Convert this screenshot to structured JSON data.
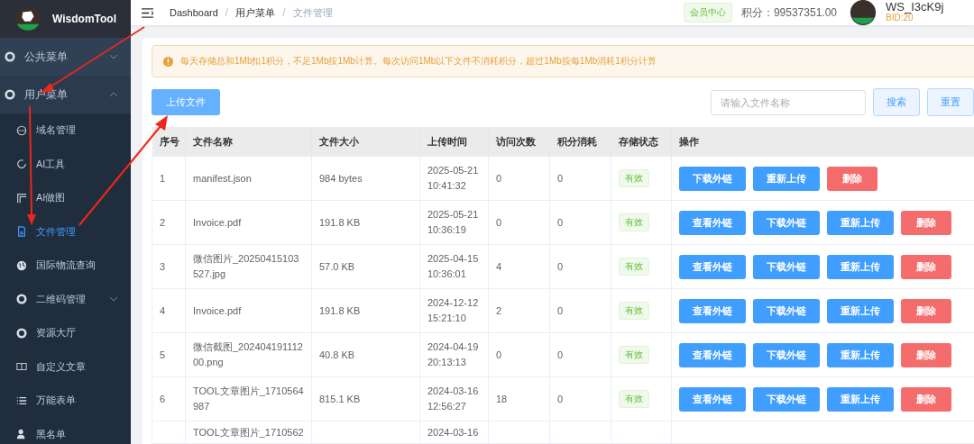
{
  "sidebar": {
    "logo_text": "WisdomTool",
    "items": [
      {
        "label": "公共菜单",
        "expanded": false
      },
      {
        "label": "用户菜单",
        "expanded": true,
        "children": [
          {
            "label": "域名管理",
            "selected": false
          },
          {
            "label": "AI工具",
            "selected": false
          },
          {
            "label": "AI做图",
            "selected": false
          },
          {
            "label": "文件管理",
            "selected": true
          },
          {
            "label": "国际物流查询",
            "selected": false
          },
          {
            "label": "二维码管理",
            "selected": false,
            "expanded": false
          },
          {
            "label": "资源大厅",
            "selected": false
          },
          {
            "label": "自定义文章",
            "selected": false
          },
          {
            "label": "万能表单",
            "selected": false
          },
          {
            "label": "黑名单",
            "selected": false
          }
        ]
      }
    ]
  },
  "header": {
    "breadcrumb": [
      "Dashboard",
      "用户菜单",
      "文件管理"
    ],
    "breadcrumb_separator": "/",
    "member_tag": "会员中心",
    "points": "积分：99537351.00",
    "username": "WS_I3cK9j",
    "bid": "BID:20"
  },
  "notice": "每天存储总和1Mb扣1积分，不足1Mb按1Mb计算。每次访问1Mb以下文件不消耗积分，超过1Mb按每1Mb消耗1积分计算",
  "toolbar": {
    "upload": "上传文件",
    "search_placeholder": "请输入文件名称",
    "search": "搜索",
    "reset": "重置"
  },
  "table": {
    "columns": [
      "序号",
      "文件名称",
      "文件大小",
      "上传时间",
      "访问次数",
      "积分消耗",
      "存储状态",
      "操作"
    ],
    "rows": [
      {
        "index": "1",
        "name": "manifest.json",
        "size": "984 bytes",
        "time": "2025-05-21 10:41:32",
        "visits": "0",
        "cost": "0",
        "status": "有效",
        "actions": [
          {
            "label": "下载外链",
            "kind": "primary"
          },
          {
            "label": "重新上传",
            "kind": "primary"
          },
          {
            "label": "删除",
            "kind": "danger"
          }
        ]
      },
      {
        "index": "2",
        "name": "Invoice.pdf",
        "size": "191.8 KB",
        "time": "2025-05-21 10:36:19",
        "visits": "0",
        "cost": "0",
        "status": "有效",
        "actions": [
          {
            "label": "查看外链",
            "kind": "primary"
          },
          {
            "label": "下载外链",
            "kind": "primary"
          },
          {
            "label": "重新上传",
            "kind": "primary"
          },
          {
            "label": "删除",
            "kind": "danger"
          }
        ]
      },
      {
        "index": "3",
        "name": "微信图片_20250415103527.jpg",
        "size": "57.0 KB",
        "time": "2025-04-15 10:36:01",
        "visits": "4",
        "cost": "0",
        "status": "有效",
        "actions": [
          {
            "label": "查看外链",
            "kind": "primary"
          },
          {
            "label": "下载外链",
            "kind": "primary"
          },
          {
            "label": "重新上传",
            "kind": "primary"
          },
          {
            "label": "删除",
            "kind": "danger"
          }
        ]
      },
      {
        "index": "4",
        "name": "Invoice.pdf",
        "size": "191.8 KB",
        "time": "2024-12-12 15:21:10",
        "visits": "2",
        "cost": "0",
        "status": "有效",
        "actions": [
          {
            "label": "查看外链",
            "kind": "primary"
          },
          {
            "label": "下载外链",
            "kind": "primary"
          },
          {
            "label": "重新上传",
            "kind": "primary"
          },
          {
            "label": "删除",
            "kind": "danger"
          }
        ]
      },
      {
        "index": "5",
        "name": "微信截图_20240419111200.png",
        "size": "40.8 KB",
        "time": "2024-04-19 20:13:13",
        "visits": "0",
        "cost": "0",
        "status": "有效",
        "actions": [
          {
            "label": "查看外链",
            "kind": "primary"
          },
          {
            "label": "下载外链",
            "kind": "primary"
          },
          {
            "label": "重新上传",
            "kind": "primary"
          },
          {
            "label": "删除",
            "kind": "danger"
          }
        ]
      },
      {
        "index": "6",
        "name": "TOOL文章图片_1710564987",
        "size": "815.1 KB",
        "time": "2024-03-16 12:56:27",
        "visits": "18",
        "cost": "0",
        "status": "有效",
        "actions": [
          {
            "label": "查看外链",
            "kind": "primary"
          },
          {
            "label": "下载外链",
            "kind": "primary"
          },
          {
            "label": "重新上传",
            "kind": "primary"
          },
          {
            "label": "删除",
            "kind": "danger"
          }
        ]
      },
      {
        "name": "TOOL文章图片_1710562",
        "time": "2024-03-16"
      }
    ]
  }
}
